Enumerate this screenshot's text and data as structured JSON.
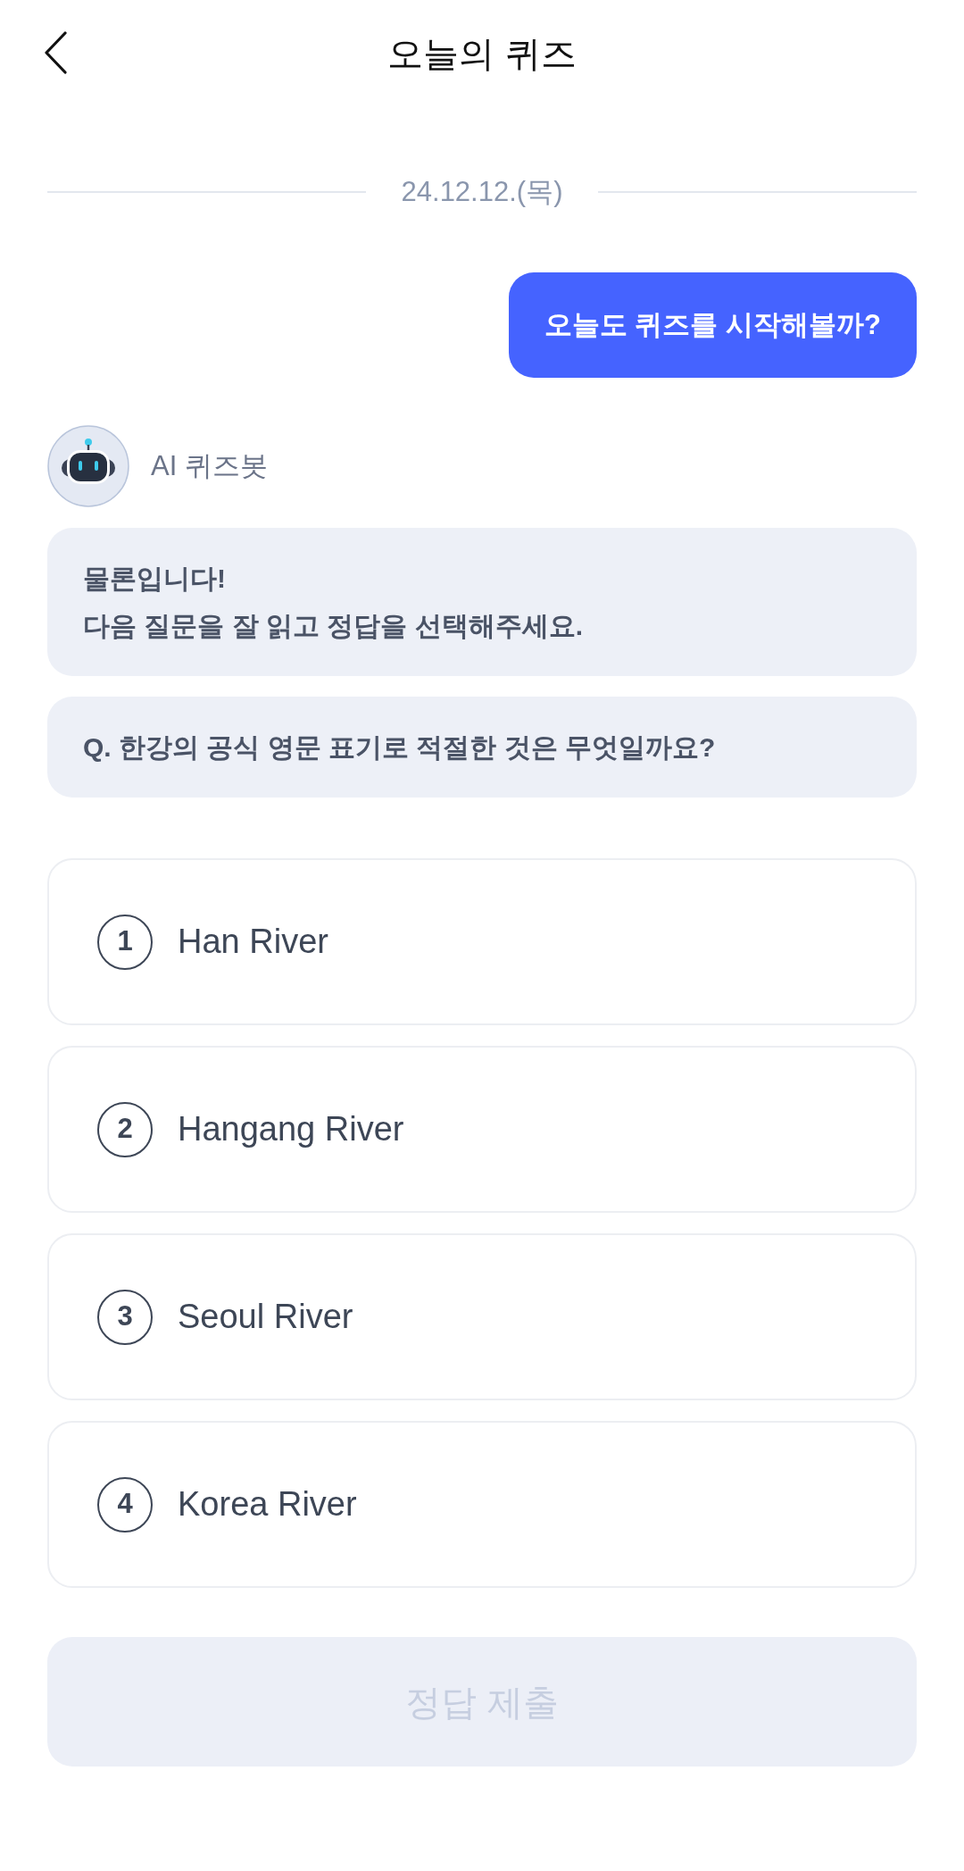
{
  "header": {
    "title": "오늘의 퀴즈"
  },
  "date_divider": "24.12.12.(목)",
  "chat": [
    {
      "kind": "user",
      "text": "오늘도 퀴즈를 시작해볼까?"
    },
    {
      "kind": "bot_header",
      "name": "AI 퀴즈봇"
    },
    {
      "kind": "bot",
      "text": "물론입니다!\n다음 질문을 잘 읽고 정답을 선택해주세요."
    },
    {
      "kind": "bot",
      "text": "Q. 한강의 공식 영문 표기로 적절한 것은 무엇일까요?"
    }
  ],
  "options": [
    {
      "number": "1",
      "label": "Han River",
      "selected": false
    },
    {
      "number": "2",
      "label": "Hangang River",
      "selected": false
    },
    {
      "number": "3",
      "label": "Seoul River",
      "selected": false
    },
    {
      "number": "4",
      "label": "Korea River",
      "selected": false
    }
  ],
  "submit_button": {
    "label": "정답 제출",
    "disabled": true
  }
}
